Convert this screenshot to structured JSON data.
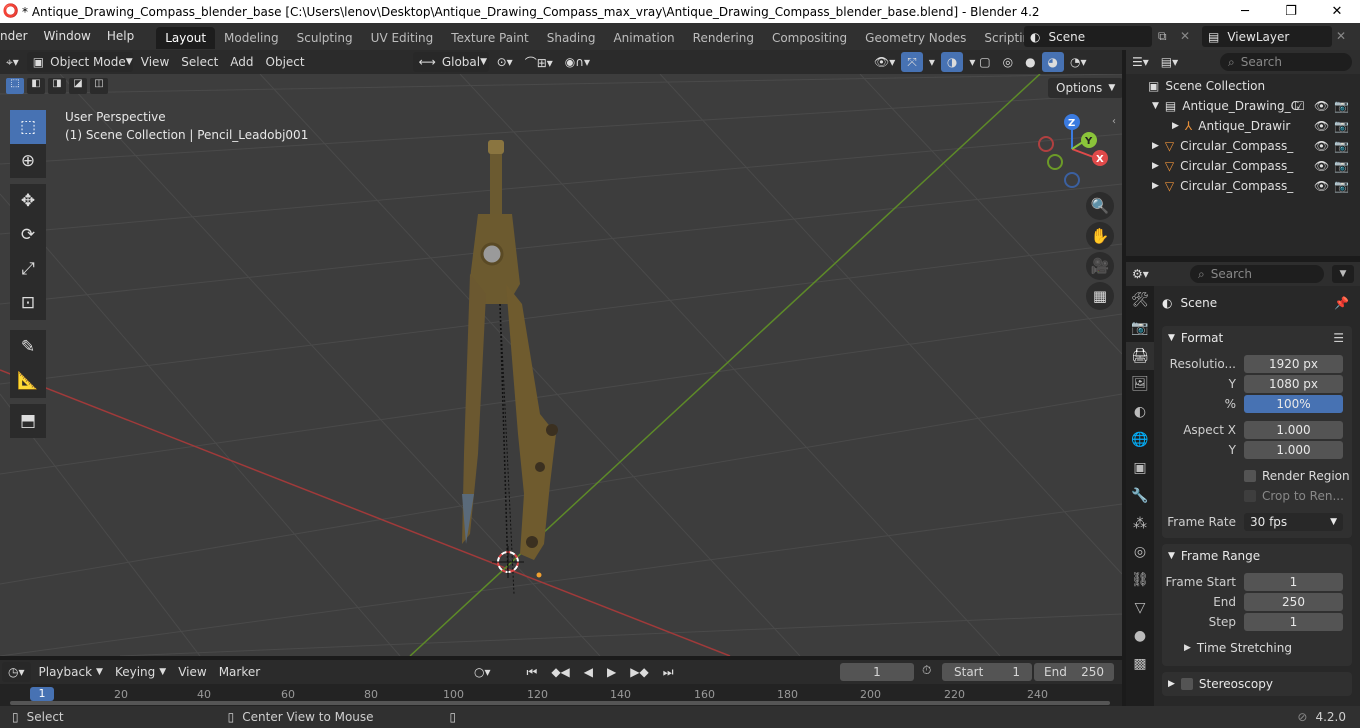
{
  "window": {
    "title": "* Antique_Drawing_Compass_blender_base [C:\\Users\\lenov\\Desktop\\Antique_Drawing_Compass_max_vray\\Antique_Drawing_Compass_blender_base.blend] - Blender 4.2",
    "minimize": "─",
    "maximize": "❐",
    "close": "✕"
  },
  "menubar": {
    "items": [
      "nder",
      "Window",
      "Help"
    ],
    "tabs": [
      "Layout",
      "Modeling",
      "Sculpting",
      "UV Editing",
      "Texture Paint",
      "Shading",
      "Animation",
      "Rendering",
      "Compositing",
      "Geometry Nodes",
      "Scripting"
    ],
    "add_tab": "+",
    "scene": "Scene",
    "view_layer": "ViewLayer"
  },
  "viewport_header": {
    "mode": "Object Mode",
    "menus": [
      "View",
      "Select",
      "Add",
      "Object"
    ],
    "orientation": "Global",
    "options": "Options"
  },
  "viewport": {
    "view_name": "User Perspective",
    "collection_info": "(1) Scene Collection | Pencil_Leadobj001",
    "gizmo": {
      "x": "X",
      "y": "Y",
      "z": "Z"
    }
  },
  "outliner": {
    "search_placeholder": "Search",
    "root": "Scene Collection",
    "items": [
      {
        "label": "Antique_Drawing_C",
        "level": 1
      },
      {
        "label": "Antique_Drawir",
        "level": 2
      },
      {
        "label": "Circular_Compass_",
        "level": 1
      },
      {
        "label": "Circular_Compass_",
        "level": 1
      },
      {
        "label": "Circular_Compass_",
        "level": 1
      }
    ]
  },
  "properties": {
    "search_placeholder": "Search",
    "context": "Scene",
    "format": {
      "title": "Format",
      "resolution_label": "Resolutio...",
      "resolution_x": "1920 px",
      "y_label": "Y",
      "resolution_y": "1080 px",
      "percent_label": "%",
      "percent": "100%",
      "aspect_x_label": "Aspect X",
      "aspect_x": "1.000",
      "aspect_y_label": "Y",
      "aspect_y": "1.000",
      "render_region": "Render Region",
      "crop": "Crop to Ren...",
      "frame_rate_label": "Frame Rate",
      "frame_rate": "30 fps"
    },
    "frame_range": {
      "title": "Frame Range",
      "start_label": "Frame Start",
      "start": "1",
      "end_label": "End",
      "end": "250",
      "step_label": "Step",
      "step": "1"
    },
    "time_stretching": "Time Stretching",
    "stereoscopy": "Stereoscopy"
  },
  "timeline": {
    "menus": [
      "Playback",
      "Keying",
      "View",
      "Marker"
    ],
    "current_frame": "1",
    "start_label": "Start",
    "start": "1",
    "end_label": "End",
    "end": "250",
    "ruler": [
      "1",
      "20",
      "40",
      "60",
      "80",
      "100",
      "120",
      "140",
      "160",
      "180",
      "200",
      "220",
      "240"
    ]
  },
  "statusbar": {
    "select": "Select",
    "center_view": "Center View to Mouse",
    "version": "4.2.0"
  },
  "colors": {
    "accent": "#4772b3",
    "x_axis": "#c23b3b",
    "y_axis": "#6c9a28",
    "blender_orange": "#e87d0d"
  }
}
